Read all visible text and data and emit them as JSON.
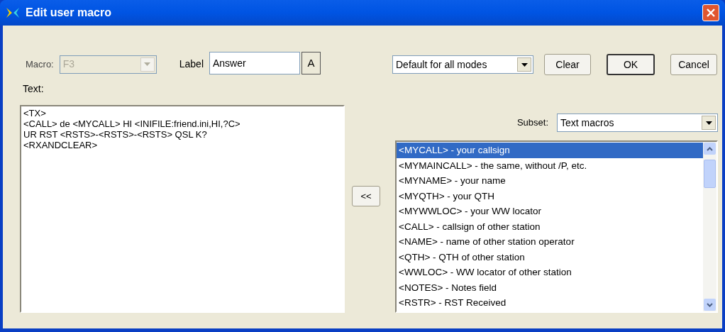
{
  "window": {
    "title": "Edit user macro"
  },
  "macro": {
    "label": "Macro:",
    "value": "F3",
    "disabled": true
  },
  "label_field": {
    "label": "Label",
    "value": "Answer",
    "font_button": "A"
  },
  "text": {
    "label": "Text:",
    "value": "<TX>\n<CALL> de <MYCALL> HI <INIFILE:friend.ini,HI,?C>\nUR RST <RSTS>-<RSTS>-<RSTS> QSL K?\n<RXANDCLEAR>"
  },
  "mode": {
    "value": "Default for all modes"
  },
  "buttons": [
    {
      "label": "Clear",
      "default": false
    },
    {
      "label": "OK",
      "default": true
    },
    {
      "label": "Cancel",
      "default": false
    }
  ],
  "insert_button": "<<",
  "subset": {
    "label": "Subset:",
    "value": "Text macros"
  },
  "macros_list": [
    {
      "text": "<MYCALL> - your callsign",
      "selected": true
    },
    {
      "text": "<MYMAINCALL> - the same, without /P, etc.",
      "selected": false
    },
    {
      "text": "<MYNAME> - your name",
      "selected": false
    },
    {
      "text": "<MYQTH> - your QTH",
      "selected": false
    },
    {
      "text": "<MYWWLOC> - your WW locator",
      "selected": false
    },
    {
      "text": "<CALL> - callsign of other station",
      "selected": false
    },
    {
      "text": "<NAME> - name of other station operator",
      "selected": false
    },
    {
      "text": "<QTH> - QTH of other station",
      "selected": false
    },
    {
      "text": "<WWLOC> - WW locator of other station",
      "selected": false
    },
    {
      "text": "<NOTES> - Notes field",
      "selected": false
    },
    {
      "text": "<RSTR> - RST Received",
      "selected": false
    }
  ]
}
